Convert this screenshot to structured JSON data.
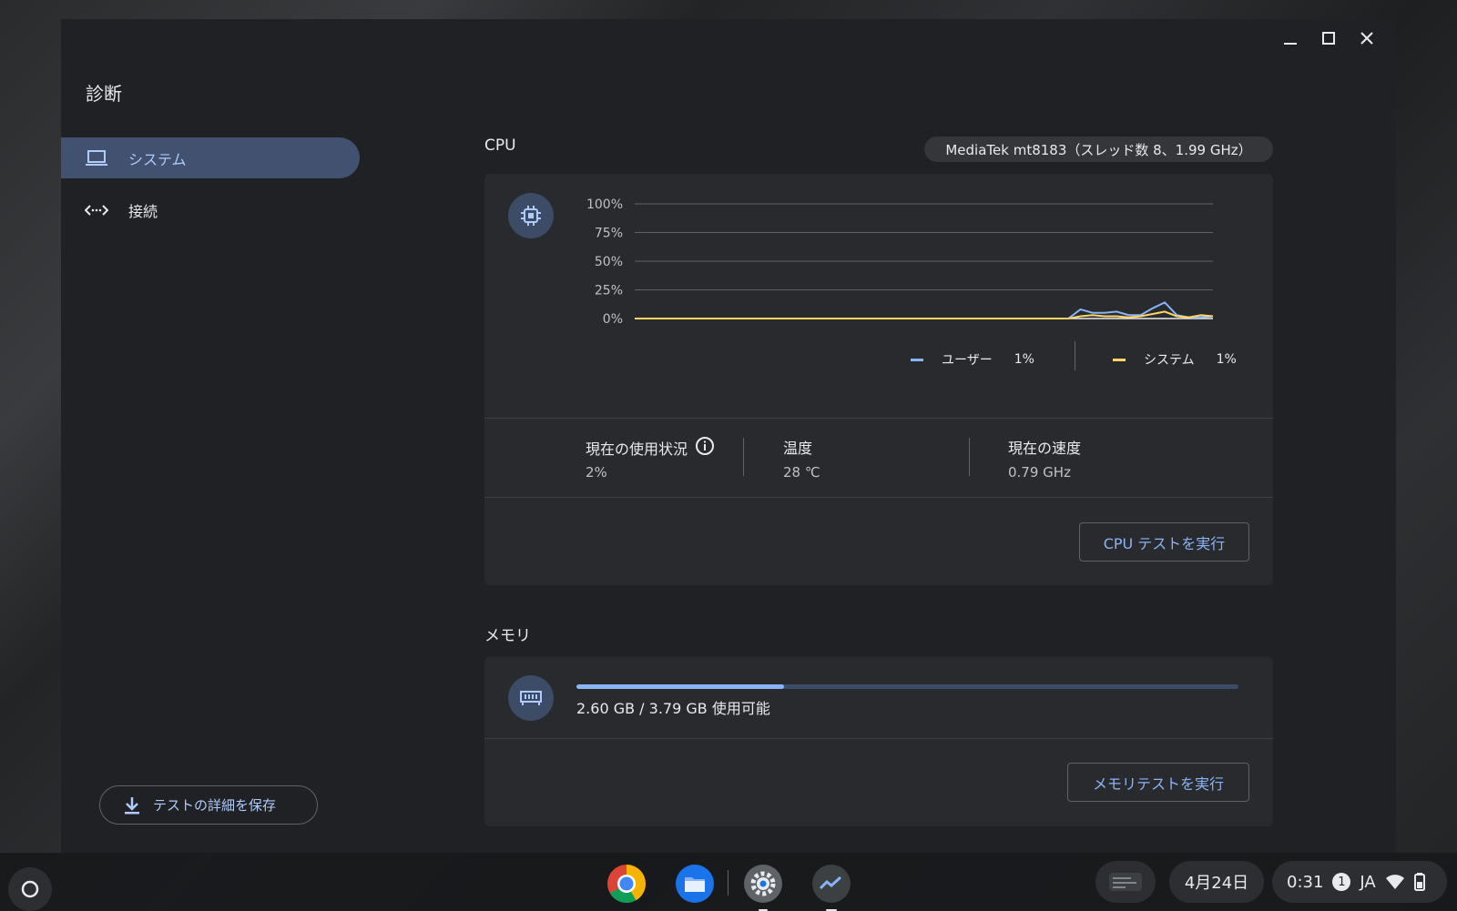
{
  "app": {
    "title": "診断"
  },
  "nav": {
    "items": [
      {
        "label": "システム",
        "icon": "laptop-icon",
        "active": true
      },
      {
        "label": "接続",
        "icon": "connection-icon",
        "active": false
      }
    ],
    "save_label": "テストの詳細を保存"
  },
  "cpu": {
    "title": "CPU",
    "chip": "MediaTek mt8183（スレッド数 8、1.99 GHz）",
    "chart_data": {
      "type": "line",
      "yticks": [
        "100%",
        "75%",
        "50%",
        "25%",
        "0%"
      ],
      "ylim": [
        0,
        100
      ],
      "series": [
        {
          "name": "ユーザー",
          "color": "#8ab4f8",
          "values": [
            0,
            0,
            0,
            0,
            0,
            0,
            0,
            0,
            0,
            0,
            0,
            0,
            0,
            0,
            0,
            0,
            0,
            0,
            0,
            0,
            0,
            0,
            0,
            0,
            0,
            0,
            0,
            0,
            0,
            0,
            0,
            0,
            0,
            0,
            0,
            0,
            0,
            8,
            5,
            5,
            6,
            3,
            3,
            9,
            14,
            3,
            1,
            1,
            2
          ]
        },
        {
          "name": "システム",
          "color": "#fdd663",
          "values": [
            0,
            0,
            0,
            0,
            0,
            0,
            0,
            0,
            0,
            0,
            0,
            0,
            0,
            0,
            0,
            0,
            0,
            0,
            0,
            0,
            0,
            0,
            0,
            0,
            0,
            0,
            0,
            0,
            0,
            0,
            0,
            0,
            0,
            0,
            0,
            0,
            0,
            2,
            3,
            2,
            2,
            1,
            2,
            4,
            6,
            2,
            1,
            3,
            2
          ]
        }
      ]
    },
    "legend": [
      {
        "label": "ユーザー",
        "value": "1%",
        "color": "#8ab4f8"
      },
      {
        "label": "システム",
        "value": "1%",
        "color": "#fdd663"
      }
    ],
    "metrics": [
      {
        "label": "現在の使用状況",
        "value": "2%"
      },
      {
        "label": "温度",
        "value": "28 ℃"
      },
      {
        "label": "現在の速度",
        "value": "0.79 GHz"
      }
    ],
    "run_label": "CPU テストを実行"
  },
  "memory": {
    "title": "メモリ",
    "usage_text": "2.60 GB / 3.79 GB 使用可能",
    "used_fraction": 0.314,
    "run_label": "メモリテストを実行"
  },
  "shelf": {
    "apps": [
      "chrome-icon",
      "files-icon",
      "settings-icon",
      "diagnostics-icon"
    ],
    "date": "4月24日",
    "time": "0:31",
    "notification_count": "1",
    "ime": "JA"
  }
}
